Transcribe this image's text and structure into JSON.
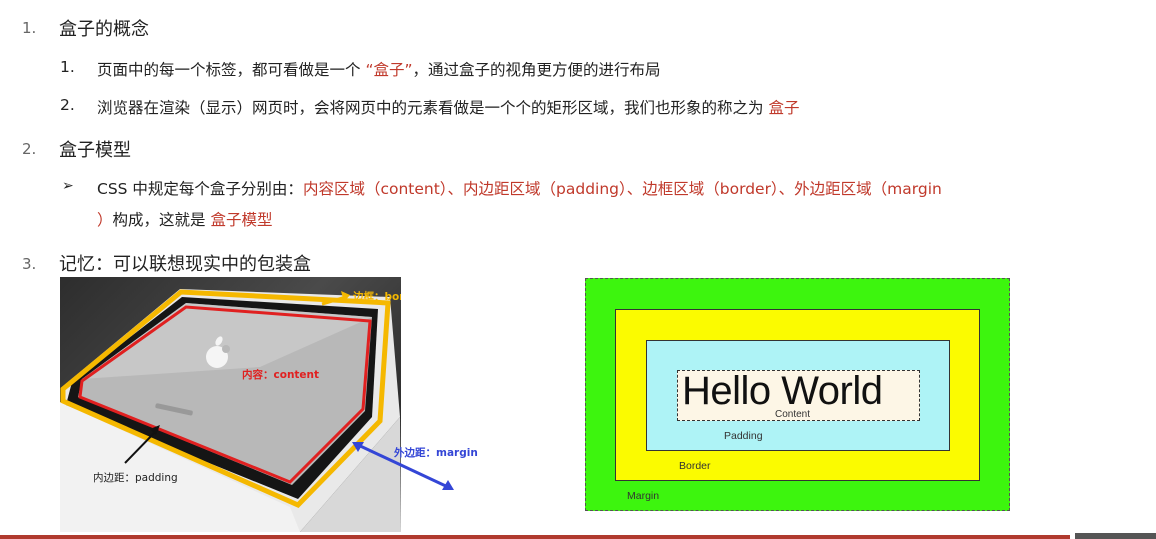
{
  "items": [
    {
      "num": "1.",
      "title": "盒子的概念",
      "subs": [
        {
          "num": "1.",
          "pre": "页面中的每一个标签，都可看做是一个 ",
          "hl": "“盒子”",
          "post": "，通过盒子的视角更方便的进行布局"
        },
        {
          "num": "2.",
          "pre": "浏览器在渲染（显示）网页时，会将网页中的元素看做是一个个的矩形区域，我们也形象的称之为 ",
          "hl": "盒子",
          "post": ""
        }
      ]
    },
    {
      "num": "2.",
      "title": "盒子模型",
      "bullet": {
        "marker": "➢",
        "pre": "CSS 中规定每个盒子分别由：",
        "hl1": "内容区域（content）、内边距区域（padding）、边框区域（border）、外边距区域（margin",
        "hl2": "）",
        "mid": "构成，这就是 ",
        "hl3": "盒子模型"
      }
    },
    {
      "num": "3.",
      "title": "记忆：可以联想现实中的包装盒"
    }
  ],
  "photo_labels": {
    "border": "边框：border",
    "content": "内容：content",
    "margin": "外边距：margin",
    "padding": "内边距：padding"
  },
  "diagram": {
    "hello": "Hello World",
    "content": "Content",
    "padding": "Padding",
    "border": "Border",
    "margin": "Margin"
  },
  "colors": {
    "highlight": "#c0392b",
    "margin_bg": "#3df50e",
    "border_bg": "#fbfb00",
    "padding_bg": "#aef3f6"
  }
}
